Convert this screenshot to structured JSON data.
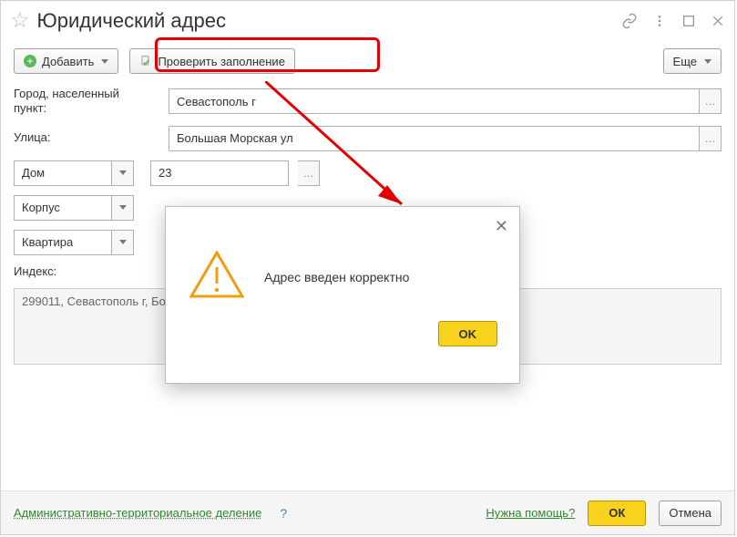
{
  "titlebar": {
    "title": "Юридический адрес"
  },
  "toolbar": {
    "add_label": "Добавить",
    "check_label": "Проверить заполнение",
    "more_label": "Еще"
  },
  "form": {
    "city_label": "Город, населенный\nпункт:",
    "city_value": "Севастополь г",
    "street_label": "Улица:",
    "street_value": "Большая Морская ул",
    "house_type": "Дом",
    "house_value": "23",
    "corpus_type": "Корпус",
    "corpus_value": "",
    "flat_type": "Квартира",
    "flat_value": "",
    "index_label": "Индекс:",
    "address_text": "299011, Севастополь г, Большая Морская ул, дом № 23"
  },
  "footer": {
    "admin_label": "Административно-территориальное деление",
    "help_label": "Нужна помощь?",
    "ok_label": "ОК",
    "cancel_label": "Отмена"
  },
  "modal": {
    "message": "Адрес введен корректно",
    "ok_label": "OK"
  }
}
